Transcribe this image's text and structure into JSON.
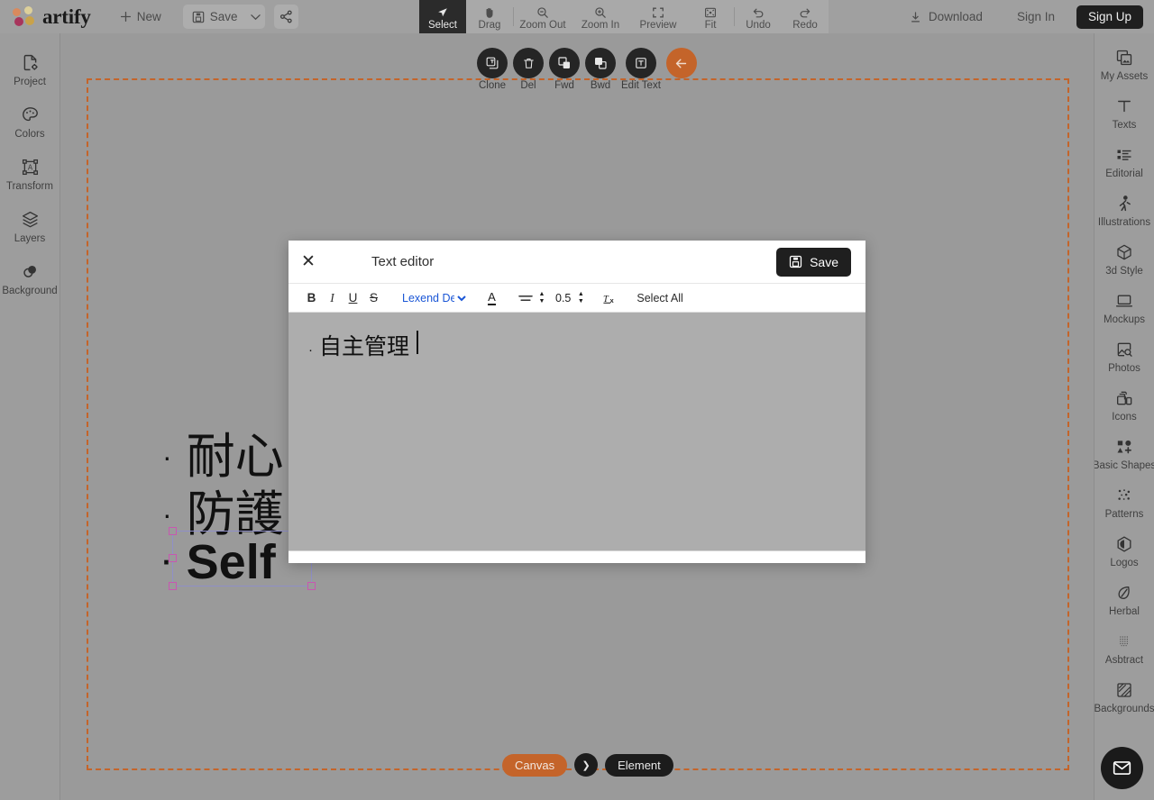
{
  "app": {
    "brand": "artify"
  },
  "topbar": {
    "new_label": "New",
    "save_label": "Save",
    "share_icon": "share-icon",
    "tools": [
      {
        "label": "Select",
        "icon": "cursor-icon",
        "active": true
      },
      {
        "label": "Drag",
        "icon": "hand-icon",
        "active": false
      },
      {
        "label": "Zoom Out",
        "icon": "zoom-out-icon",
        "active": false
      },
      {
        "label": "Zoom In",
        "icon": "zoom-in-icon",
        "active": false
      },
      {
        "label": "Preview",
        "icon": "preview-icon",
        "active": false
      },
      {
        "label": "Fit",
        "icon": "fit-icon",
        "active": false
      },
      {
        "label": "Undo",
        "icon": "undo-icon",
        "active": false
      },
      {
        "label": "Redo",
        "icon": "redo-icon",
        "active": false
      }
    ],
    "download_label": "Download",
    "signin_label": "Sign In",
    "signup_label": "Sign Up"
  },
  "left_rail": {
    "items": [
      {
        "label": "Project",
        "icon": "file-gear-icon"
      },
      {
        "label": "Colors",
        "icon": "palette-icon"
      },
      {
        "label": "Transform",
        "icon": "transform-icon"
      },
      {
        "label": "Layers",
        "icon": "layers-icon"
      },
      {
        "label": "Background",
        "icon": "background-icon"
      }
    ]
  },
  "right_rail": {
    "items": [
      {
        "label": "My Assets",
        "icon": "assets-icon"
      },
      {
        "label": "Texts",
        "icon": "text-t-icon"
      },
      {
        "label": "Editorial",
        "icon": "editorial-icon"
      },
      {
        "label": "Illustrations",
        "icon": "illustration-icon"
      },
      {
        "label": "3d Style",
        "icon": "cube-icon"
      },
      {
        "label": "Mockups",
        "icon": "laptop-icon"
      },
      {
        "label": "Photos",
        "icon": "photo-search-icon"
      },
      {
        "label": "Icons",
        "icon": "icons-icon"
      },
      {
        "label": "Basic Shapes",
        "icon": "shapes-icon"
      },
      {
        "label": "Patterns",
        "icon": "patterns-icon"
      },
      {
        "label": "Logos",
        "icon": "logos-icon"
      },
      {
        "label": "Herbal",
        "icon": "leaf-icon"
      },
      {
        "label": "Asbtract",
        "icon": "abstract-icon"
      },
      {
        "label": "Backgrounds",
        "icon": "backgrounds-icon"
      }
    ]
  },
  "object_toolbar": {
    "items": [
      {
        "label": "Clone",
        "icon": "clone-icon"
      },
      {
        "label": "Del",
        "icon": "trash-icon"
      },
      {
        "label": "Fwd",
        "icon": "bring-forward-icon"
      },
      {
        "label": "Bwd",
        "icon": "send-backward-icon"
      },
      {
        "label": "Edit Text",
        "icon": "edit-text-icon"
      }
    ],
    "back_icon": "arrow-left-icon",
    "back_color": "#c4642a"
  },
  "canvas": {
    "border_color": "#c4642a",
    "lines": [
      {
        "bullet": "·",
        "text": "耐心"
      },
      {
        "bullet": "·",
        "text": "防護"
      },
      {
        "bullet": "·",
        "text": "Self"
      }
    ],
    "selection": {
      "handle_color": "#c758b0",
      "outline_color": "#8f8fc8"
    }
  },
  "text_editor": {
    "title": "Text editor",
    "close_icon": "close-icon",
    "save_label": "Save",
    "save_icon": "save-disk-icon",
    "toolbar": {
      "bold": "B",
      "italic": "I",
      "underline": "U",
      "strike": "S",
      "font_value": "Lexend Deca",
      "font_options": [
        "Lexend Deca"
      ],
      "color_icon": "text-color-icon",
      "align_icon": "align-icon",
      "align_spinner_icon": "spinner-icon",
      "line_height_value": "0.5",
      "line_height_spinner_icon": "spinner-icon",
      "clear_format_icon": "clear-format-icon",
      "select_all_label": "Select All"
    },
    "content": {
      "bullet": "·",
      "text": "自主管理"
    }
  },
  "bottom_bar": {
    "canvas_label": "Canvas",
    "next_icon": "chevron-right-icon",
    "element_label": "Element",
    "canvas_color": "#c4642a"
  },
  "chat": {
    "icon": "mail-icon"
  }
}
